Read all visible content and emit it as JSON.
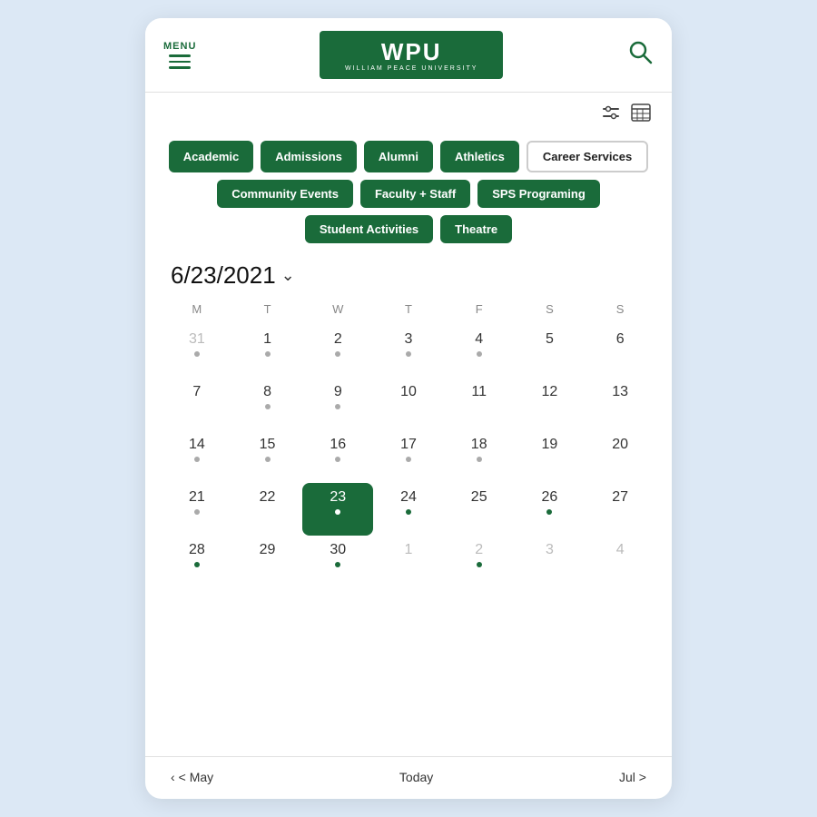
{
  "header": {
    "menu_label": "MENU",
    "logo_main": "WPU",
    "logo_sub": "WILLIAM PEACE UNIVERSITY"
  },
  "toolbar": {
    "filter_icon": "⊟",
    "calendar_icon": "▦"
  },
  "filters": {
    "row1": [
      {
        "label": "Academic",
        "active": true
      },
      {
        "label": "Admissions",
        "active": true
      },
      {
        "label": "Alumni",
        "active": true
      },
      {
        "label": "Athletics",
        "active": true
      },
      {
        "label": "Career Services",
        "active": false
      }
    ],
    "row2": [
      {
        "label": "Community Events",
        "active": true
      },
      {
        "label": "Faculty + Staff",
        "active": true
      },
      {
        "label": "SPS Programing",
        "active": true
      }
    ],
    "row3": [
      {
        "label": "Student Activities",
        "active": true
      },
      {
        "label": "Theatre",
        "active": true
      }
    ]
  },
  "calendar": {
    "title": "6/23/2021",
    "day_names": [
      "M",
      "T",
      "W",
      "T",
      "F",
      "S",
      "S"
    ],
    "weeks": [
      [
        {
          "day": "31",
          "other": true,
          "dot": "gray"
        },
        {
          "day": "1",
          "dot": "gray"
        },
        {
          "day": "2",
          "dot": "gray"
        },
        {
          "day": "3",
          "dot": "gray"
        },
        {
          "day": "4",
          "dot": "gray"
        },
        {
          "day": "5",
          "dot": ""
        },
        {
          "day": "6",
          "dot": ""
        }
      ],
      [
        {
          "day": "7",
          "dot": ""
        },
        {
          "day": "8",
          "dot": "gray"
        },
        {
          "day": "9",
          "dot": "gray"
        },
        {
          "day": "10",
          "dot": ""
        },
        {
          "day": "11",
          "dot": ""
        },
        {
          "day": "12",
          "dot": ""
        },
        {
          "day": "13",
          "dot": ""
        }
      ],
      [
        {
          "day": "14",
          "dot": "gray"
        },
        {
          "day": "15",
          "dot": "gray"
        },
        {
          "day": "16",
          "dot": "gray"
        },
        {
          "day": "17",
          "dot": "gray"
        },
        {
          "day": "18",
          "dot": "gray"
        },
        {
          "day": "19",
          "dot": ""
        },
        {
          "day": "20",
          "dot": ""
        }
      ],
      [
        {
          "day": "21",
          "dot": "gray"
        },
        {
          "day": "22",
          "dot": ""
        },
        {
          "day": "23",
          "today": true,
          "dot": "today"
        },
        {
          "day": "24",
          "dot": "green"
        },
        {
          "day": "25",
          "dot": ""
        },
        {
          "day": "26",
          "dot": "green"
        },
        {
          "day": "27",
          "dot": ""
        }
      ],
      [
        {
          "day": "28",
          "dot": "green"
        },
        {
          "day": "29",
          "dot": ""
        },
        {
          "day": "30",
          "dot": "green"
        },
        {
          "day": "1",
          "other": true,
          "dot": ""
        },
        {
          "day": "2",
          "other": true,
          "dot": "green"
        },
        {
          "day": "3",
          "other": true,
          "dot": ""
        },
        {
          "day": "4",
          "other": true,
          "dot": ""
        }
      ]
    ],
    "nav_prev": "< May",
    "nav_today": "Today",
    "nav_next": "Jul >"
  }
}
